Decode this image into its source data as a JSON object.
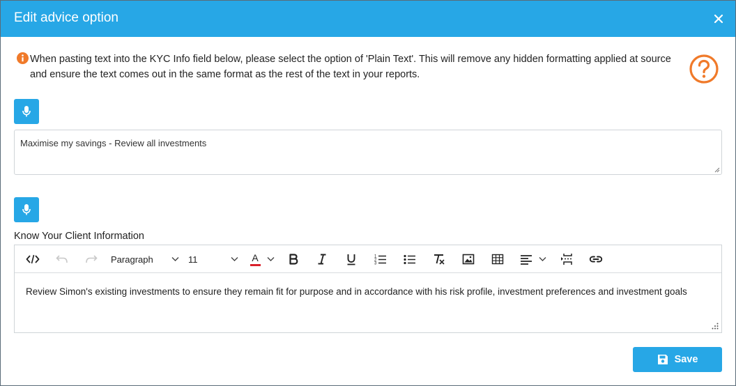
{
  "dialog": {
    "title": "Edit advice option"
  },
  "notice": {
    "text": "When pasting text into the KYC Info field below, please select the option of 'Plain Text'. This will remove any hidden formatting applied at source and ensure the text comes out in the same format as the rest of the text in your reports."
  },
  "summary_field": {
    "value": "Maximise my savings - Review all investments"
  },
  "kyc": {
    "label": "Know Your Client Information",
    "toolbar": {
      "block_format": "Paragraph",
      "font_size": "11",
      "font_color_glyph": "A",
      "font_color_underline": "#d9202a"
    },
    "content": "Review Simon's existing investments to ensure they remain fit for purpose and in accordance with his risk profile, investment preferences and investment goals"
  },
  "actions": {
    "save_label": "Save"
  },
  "colors": {
    "header": "#27a7e6",
    "accent": "#27a7e6",
    "warning": "#f07a2a"
  },
  "icons": [
    "close-icon",
    "info-icon",
    "help-icon",
    "microphone-icon",
    "code-icon",
    "undo-icon",
    "redo-icon",
    "bold-icon",
    "italic-icon",
    "underline-icon",
    "ordered-list-icon",
    "bullet-list-icon",
    "clear-format-icon",
    "image-icon",
    "table-icon",
    "align-icon",
    "page-break-icon",
    "link-icon",
    "save-icon"
  ]
}
